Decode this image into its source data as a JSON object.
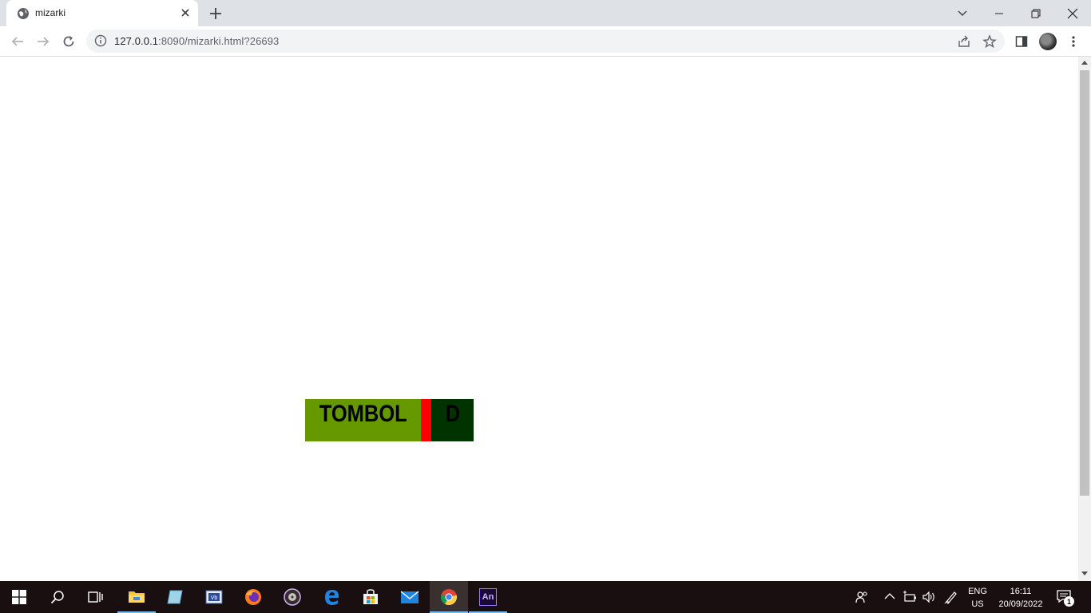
{
  "browser": {
    "tab": {
      "title": "mizarki",
      "favicon": "globe-icon"
    },
    "new_tab_icon": "plus-icon",
    "window_controls": [
      "tab-search-icon",
      "minimize-icon",
      "restore-icon",
      "close-icon"
    ],
    "address_bar": {
      "url_host": "127.0.0.1",
      "url_rest": ":8090/mizarki.html?26693",
      "security_icon": "info-icon"
    }
  },
  "page": {
    "buttons": [
      {
        "label": "TOMBOL",
        "color": "#669900"
      },
      {
        "label": "",
        "color": "#ff0000"
      },
      {
        "label": "D",
        "color": "#003300"
      }
    ]
  },
  "taskbar": {
    "apps": [
      "start-icon",
      "search-icon",
      "task-view-icon",
      "file-explorer-icon",
      "notepad-icon",
      "vb-icon",
      "firefox-icon",
      "media-player-icon",
      "edge-icon",
      "store-icon",
      "mail-icon",
      "chrome-icon",
      "animate-icon"
    ],
    "animate_label": "An",
    "language": {
      "line1": "ENG",
      "line2": "US"
    },
    "clock": {
      "time": "16:11",
      "date": "20/09/2022"
    },
    "notification_count": "1"
  }
}
